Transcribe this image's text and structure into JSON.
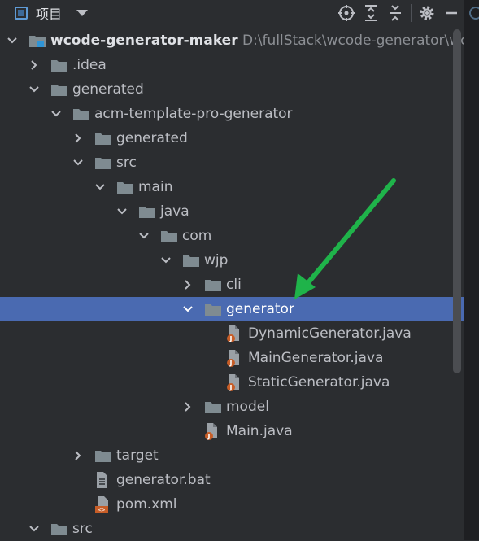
{
  "toolbar": {
    "title": "项目",
    "icons": [
      "locate-icon",
      "expand-all-icon",
      "collapse-all-icon",
      "settings-icon",
      "hide-icon"
    ]
  },
  "tree": {
    "rows": [
      {
        "label": "wcode-generator-maker",
        "path": "D:\\fullStack\\wcode-generator\\wc",
        "kind": "module",
        "state": "expanded"
      },
      {
        "label": ".idea",
        "kind": "folder",
        "state": "collapsed"
      },
      {
        "label": "generated",
        "kind": "folder",
        "state": "expanded"
      },
      {
        "label": "acm-template-pro-generator",
        "kind": "folder",
        "state": "expanded"
      },
      {
        "label": "generated",
        "kind": "folder",
        "state": "collapsed"
      },
      {
        "label": "src",
        "kind": "folder",
        "state": "expanded"
      },
      {
        "label": "main",
        "kind": "folder",
        "state": "expanded"
      },
      {
        "label": "java",
        "kind": "folder",
        "state": "expanded"
      },
      {
        "label": "com",
        "kind": "folder",
        "state": "expanded"
      },
      {
        "label": "wjp",
        "kind": "folder",
        "state": "expanded"
      },
      {
        "label": "cli",
        "kind": "folder",
        "state": "collapsed"
      },
      {
        "label": "generator",
        "kind": "folder",
        "state": "expanded",
        "selected": true
      },
      {
        "label": "DynamicGenerator.java",
        "kind": "java"
      },
      {
        "label": "MainGenerator.java",
        "kind": "java"
      },
      {
        "label": "StaticGenerator.java",
        "kind": "java"
      },
      {
        "label": "model",
        "kind": "folder",
        "state": "collapsed"
      },
      {
        "label": "Main.java",
        "kind": "java"
      },
      {
        "label": "target",
        "kind": "folder",
        "state": "collapsed"
      },
      {
        "label": "generator.bat",
        "kind": "text"
      },
      {
        "label": "pom.xml",
        "kind": "xml"
      },
      {
        "label": "src",
        "kind": "folder",
        "state": "expanded"
      }
    ]
  },
  "colors": {
    "background": "#2b2d30",
    "selection": "#4a6ab1",
    "folder": "#7f8b91",
    "annotation_arrow": "#1fb34a",
    "java_badge": "#c75d27"
  }
}
